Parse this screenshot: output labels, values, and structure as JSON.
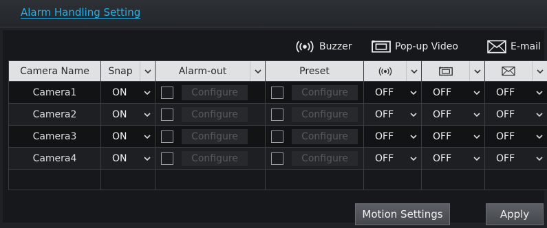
{
  "header": {
    "title": "Alarm Handling Setting"
  },
  "legend": {
    "buzzer": {
      "label": "Buzzer",
      "icon": "buzzer-icon"
    },
    "popup": {
      "label": "Pop-up Video",
      "icon": "popup-video-icon"
    },
    "email": {
      "label": "E-mail",
      "icon": "email-icon"
    }
  },
  "table": {
    "headers": {
      "camera": "Camera Name",
      "snap": "Snap",
      "alarm_out": "Alarm-out",
      "preset": "Preset"
    },
    "rows": [
      {
        "camera": "Camera1",
        "snap": "ON",
        "alarm_out_btn": "Configure",
        "preset_btn": "Configure",
        "buzzer": "OFF",
        "popup": "OFF",
        "email": "OFF"
      },
      {
        "camera": "Camera2",
        "snap": "ON",
        "alarm_out_btn": "Configure",
        "preset_btn": "Configure",
        "buzzer": "OFF",
        "popup": "OFF",
        "email": "OFF"
      },
      {
        "camera": "Camera3",
        "snap": "ON",
        "alarm_out_btn": "Configure",
        "preset_btn": "Configure",
        "buzzer": "OFF",
        "popup": "OFF",
        "email": "OFF"
      },
      {
        "camera": "Camera4",
        "snap": "ON",
        "alarm_out_btn": "Configure",
        "preset_btn": "Configure",
        "buzzer": "OFF",
        "popup": "OFF",
        "email": "OFF"
      }
    ]
  },
  "buttons": {
    "motion": "Motion Settings",
    "apply": "Apply"
  },
  "colors": {
    "accent": "#29aee6",
    "header_bg": "#e0e1e2",
    "panel_bg": "#16181b"
  }
}
